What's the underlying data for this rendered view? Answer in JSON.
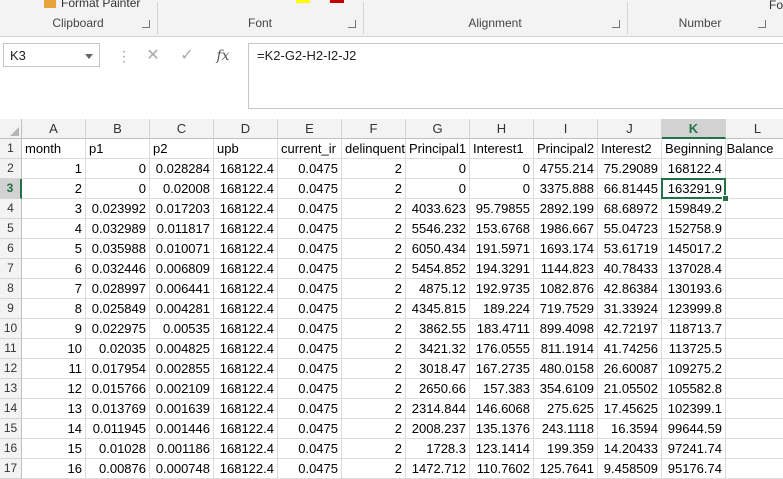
{
  "ribbon": {
    "format_painter": "Format Painter",
    "groups": [
      "Clipboard",
      "Font",
      "Alignment",
      "Number"
    ],
    "cut_off_text": "Fo"
  },
  "formula_bar": {
    "name_box": "K3",
    "cancel_icon": "cancel-icon",
    "enter_icon": "check-icon",
    "fx_label": "fx",
    "formula": "=K2-G2-H2-I2-J2"
  },
  "columns": [
    "A",
    "B",
    "C",
    "D",
    "E",
    "F",
    "G",
    "H",
    "I",
    "J",
    "K",
    "L"
  ],
  "selected_cell": {
    "column": "K",
    "row": 3
  },
  "rows": [
    {
      "n": "1",
      "cells": [
        "month",
        "p1",
        "p2",
        "upb",
        "current_ir",
        "delinquent",
        "Principal1",
        "Interest1",
        "Principal2",
        "Interest2",
        "Beginning Balance",
        ""
      ]
    },
    {
      "n": "2",
      "cells": [
        "1",
        "0",
        "0.028284",
        "168122.4",
        "0.0475",
        "2",
        "0",
        "0",
        "4755.214",
        "75.29089",
        "168122.4",
        ""
      ]
    },
    {
      "n": "3",
      "cells": [
        "2",
        "0",
        "0.02008",
        "168122.4",
        "0.0475",
        "2",
        "0",
        "0",
        "3375.888",
        "66.81445",
        "163291.9",
        ""
      ]
    },
    {
      "n": "4",
      "cells": [
        "3",
        "0.023992",
        "0.017203",
        "168122.4",
        "0.0475",
        "2",
        "4033.623",
        "95.79855",
        "2892.199",
        "68.68972",
        "159849.2",
        ""
      ]
    },
    {
      "n": "5",
      "cells": [
        "4",
        "0.032989",
        "0.011817",
        "168122.4",
        "0.0475",
        "2",
        "5546.232",
        "153.6768",
        "1986.667",
        "55.04723",
        "152758.9",
        ""
      ]
    },
    {
      "n": "6",
      "cells": [
        "5",
        "0.035988",
        "0.010071",
        "168122.4",
        "0.0475",
        "2",
        "6050.434",
        "191.5971",
        "1693.174",
        "53.61719",
        "145017.2",
        ""
      ]
    },
    {
      "n": "7",
      "cells": [
        "6",
        "0.032446",
        "0.006809",
        "168122.4",
        "0.0475",
        "2",
        "5454.852",
        "194.3291",
        "1144.823",
        "40.78433",
        "137028.4",
        ""
      ]
    },
    {
      "n": "8",
      "cells": [
        "7",
        "0.028997",
        "0.006441",
        "168122.4",
        "0.0475",
        "2",
        "4875.12",
        "192.9735",
        "1082.876",
        "42.86384",
        "130193.6",
        ""
      ]
    },
    {
      "n": "9",
      "cells": [
        "8",
        "0.025849",
        "0.004281",
        "168122.4",
        "0.0475",
        "2",
        "4345.815",
        "189.224",
        "719.7529",
        "31.33924",
        "123999.8",
        ""
      ]
    },
    {
      "n": "10",
      "cells": [
        "9",
        "0.022975",
        "0.00535",
        "168122.4",
        "0.0475",
        "2",
        "3862.55",
        "183.4711",
        "899.4098",
        "42.72197",
        "118713.7",
        ""
      ]
    },
    {
      "n": "11",
      "cells": [
        "10",
        "0.02035",
        "0.004825",
        "168122.4",
        "0.0475",
        "2",
        "3421.32",
        "176.0555",
        "811.1914",
        "41.74256",
        "113725.5",
        ""
      ]
    },
    {
      "n": "12",
      "cells": [
        "11",
        "0.017954",
        "0.002855",
        "168122.4",
        "0.0475",
        "2",
        "3018.47",
        "167.2735",
        "480.0158",
        "26.60087",
        "109275.2",
        ""
      ]
    },
    {
      "n": "13",
      "cells": [
        "12",
        "0.015766",
        "0.002109",
        "168122.4",
        "0.0475",
        "2",
        "2650.66",
        "157.383",
        "354.6109",
        "21.05502",
        "105582.8",
        ""
      ]
    },
    {
      "n": "14",
      "cells": [
        "13",
        "0.013769",
        "0.001639",
        "168122.4",
        "0.0475",
        "2",
        "2314.844",
        "146.6068",
        "275.625",
        "17.45625",
        "102399.1",
        ""
      ]
    },
    {
      "n": "15",
      "cells": [
        "14",
        "0.011945",
        "0.001446",
        "168122.4",
        "0.0475",
        "2",
        "2008.237",
        "135.1376",
        "243.1118",
        "16.3594",
        "99644.59",
        ""
      ]
    },
    {
      "n": "16",
      "cells": [
        "15",
        "0.01028",
        "0.001186",
        "168122.4",
        "0.0475",
        "2",
        "1728.3",
        "123.1414",
        "199.359",
        "14.20433",
        "97241.74",
        ""
      ]
    },
    {
      "n": "17",
      "cells": [
        "16",
        "0.00876",
        "0.000748",
        "168122.4",
        "0.0475",
        "2",
        "1472.712",
        "110.7602",
        "125.7641",
        "9.458509",
        "95176.74",
        ""
      ]
    }
  ],
  "colors": {
    "accent": "#217346",
    "header_bg": "#f3f3f3",
    "gridline": "#dadcdd"
  }
}
